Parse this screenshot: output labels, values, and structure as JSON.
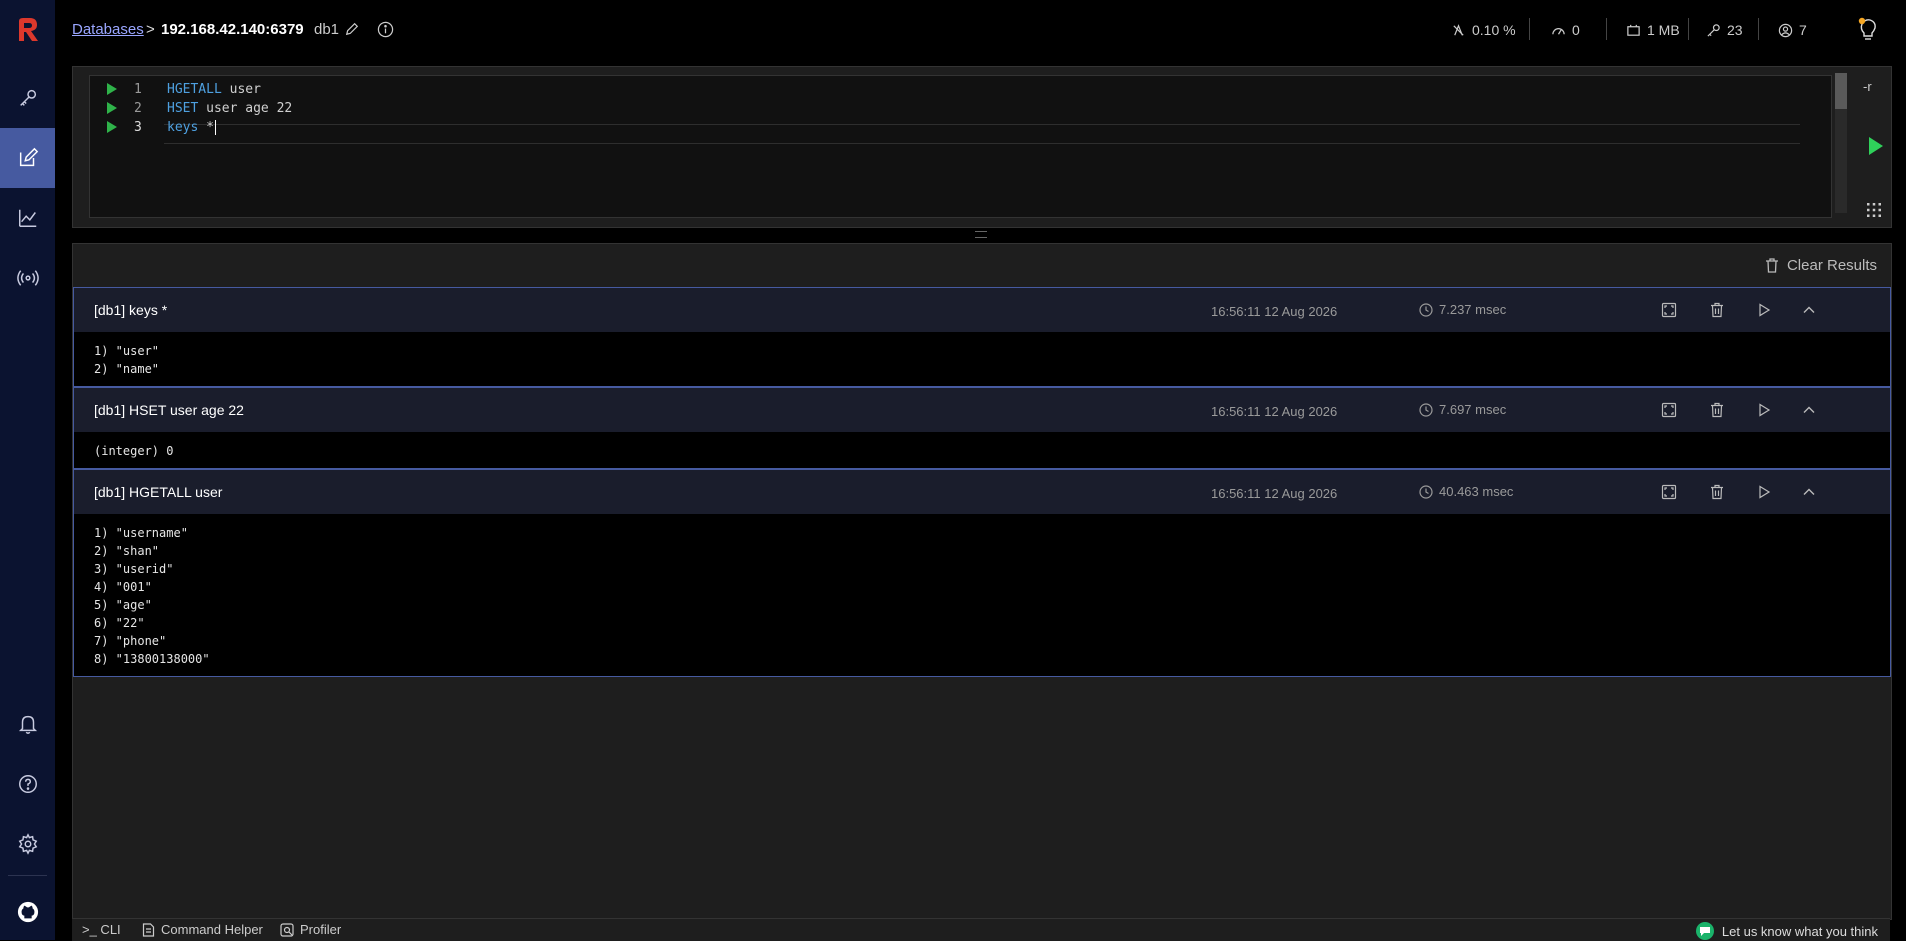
{
  "breadcrumb": {
    "databases": "Databases",
    "separator": ">",
    "host": "192.168.42.140:6379",
    "db": "db1"
  },
  "stats": {
    "cpu": "0.10 %",
    "ops": "0",
    "memory": "1 MB",
    "keys": "23",
    "clients": "7"
  },
  "editor": {
    "lines": [
      {
        "num": "1",
        "cmd": "HGETALL",
        "args": " user"
      },
      {
        "num": "2",
        "cmd": "HSET",
        "args": " user age 22"
      },
      {
        "num": "3",
        "cmd": "keys",
        "args": " *"
      }
    ],
    "option_label": "-r"
  },
  "results": {
    "clear_label": "Clear Results",
    "items": [
      {
        "title": "[db1] keys *",
        "time": "16:56:11 12 Aug 2026",
        "duration": "7.237 msec",
        "output": "1) \"user\"\n2) \"name\""
      },
      {
        "title": "[db1] HSET user age 22",
        "time": "16:56:11 12 Aug 2026",
        "duration": "7.697 msec",
        "output": "(integer) 0"
      },
      {
        "title": "[db1] HGETALL user",
        "time": "16:56:11 12 Aug 2026",
        "duration": "40.463 msec",
        "output": "1) \"username\"\n2) \"shan\"\n3) \"userid\"\n4) \"001\"\n5) \"age\"\n6) \"22\"\n7) \"phone\"\n8) \"13800138000\""
      }
    ]
  },
  "bottombar": {
    "cli": ">_ CLI",
    "helper": "Command Helper",
    "profiler": "Profiler",
    "feedback": "Let us know what you think"
  },
  "colors": {
    "sidebar_bg": "#0b1330",
    "active_nav": "#465aa0",
    "run_green": "#2fb34a",
    "link": "#9aa6ff",
    "keyword": "#4ea0e0",
    "logo_red": "#dc382c"
  }
}
